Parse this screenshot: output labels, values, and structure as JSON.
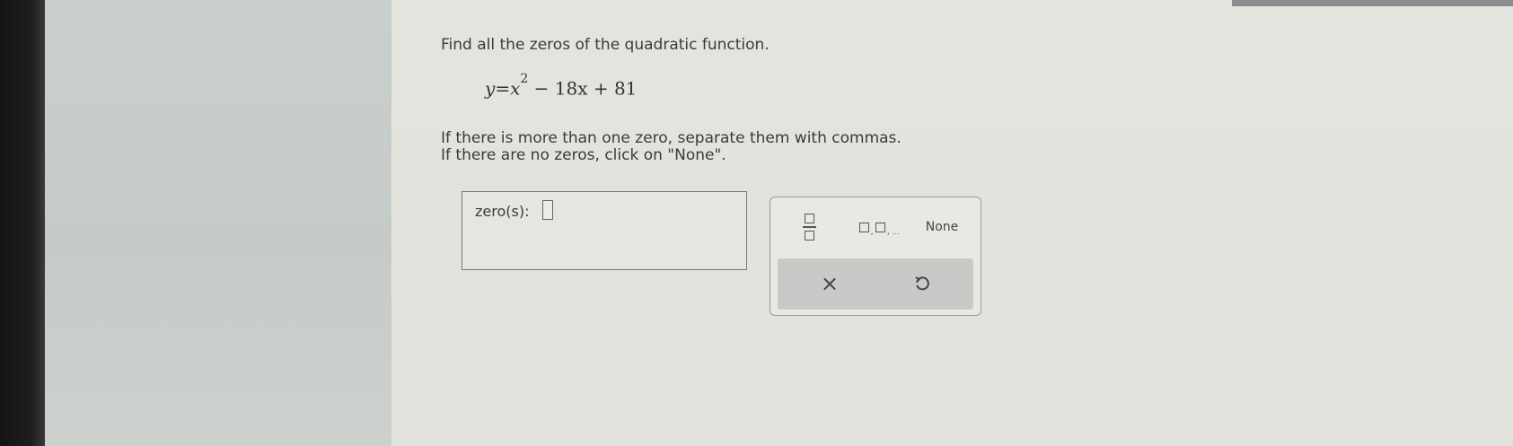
{
  "question": {
    "line1": "Find all the zeros of the quadratic function.",
    "equation": {
      "lhs": "y",
      "equals": "=",
      "base": "x",
      "exponent": "2",
      "rest": " − 18x + 81"
    },
    "instruction1": "If there is more than one zero, separate them with commas.",
    "instruction2": "If there are no zeros, click on \"None\"."
  },
  "answer": {
    "label": "zero(s):",
    "value": ""
  },
  "keypad": {
    "fraction_button": "fraction",
    "list_button": "list",
    "list_comma": ",",
    "list_dots": "...",
    "none_label": "None",
    "clear_symbol": "×",
    "undo_button": "undo"
  },
  "colors": {
    "background": "#e3e3de",
    "left_panel": "#c8cdca",
    "keypad_bar": "#c9cac7"
  }
}
